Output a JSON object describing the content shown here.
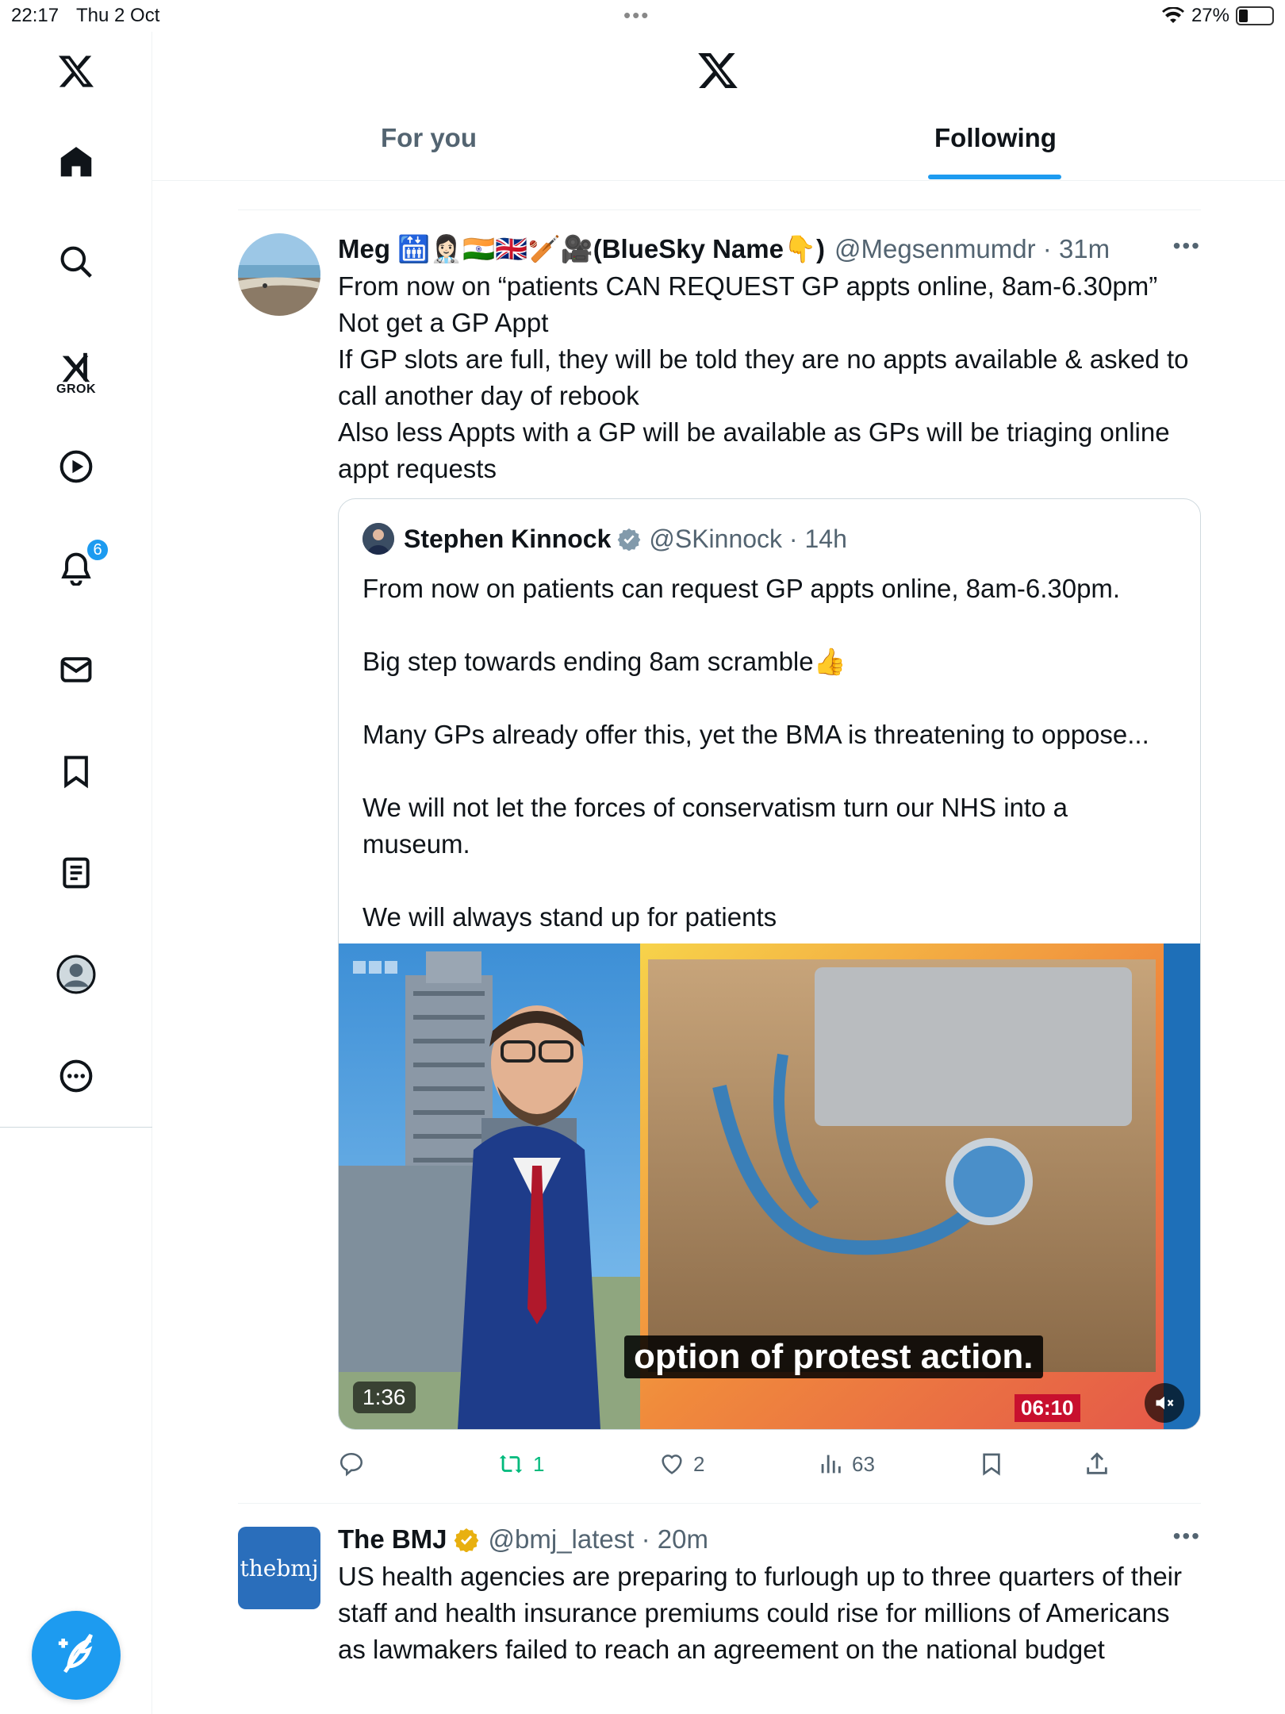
{
  "status_bar": {
    "time": "22:17",
    "date": "Thu 2 Oct",
    "battery_text": "27%",
    "battery_level": 0.27
  },
  "sidebar": {
    "items": [
      {
        "name": "x-logo",
        "icon": "x-logo-icon"
      },
      {
        "name": "home",
        "icon": "home-icon"
      },
      {
        "name": "search",
        "icon": "search-icon"
      },
      {
        "name": "grok",
        "icon": "grok-icon",
        "label": "GROK"
      },
      {
        "name": "video",
        "icon": "play-icon"
      },
      {
        "name": "notifications",
        "icon": "bell-icon",
        "badge": "6"
      },
      {
        "name": "messages",
        "icon": "mail-icon"
      },
      {
        "name": "bookmarks",
        "icon": "bookmark-icon"
      },
      {
        "name": "articles",
        "icon": "article-icon"
      },
      {
        "name": "profile",
        "icon": "profile-icon"
      },
      {
        "name": "more",
        "icon": "more-circle-icon"
      }
    ],
    "compose_icon": "compose-feather-icon"
  },
  "header": {
    "tabs": [
      {
        "label": "For you",
        "active": false
      },
      {
        "label": "Following",
        "active": true
      }
    ],
    "accent": "#1d9bf0"
  },
  "tweets": [
    {
      "name": "Meg 🛗👩🏻‍⚕️🇮🇳🇬🇧🏏🎥(BlueSky Name👇)",
      "handle": "@Megsenmumdr",
      "time": "31m",
      "meta": "@Megsenmumdr · 31m",
      "text": "From now on “patients CAN REQUEST GP appts online, 8am-6.30pm”\nNot get a GP Appt\nIf GP slots are full, they will be told they are no appts available & asked to call another day of rebook\nAlso less Appts with a GP will be available as GPs will be triaging online appt requests",
      "quote": {
        "name": "Stephen Kinnock",
        "meta": "@SKinnock · 14h",
        "text": "From now on patients can request GP appts online, 8am-6.30pm.\n\nBig step towards ending 8am scramble👍\n\nMany GPs already offer this, yet the BMA is threatening to oppose...\n\nWe will not let the forces of conservatism turn our NHS into a museum.\n\nWe will always stand up for patients",
        "video": {
          "caption": "option of protest action.",
          "duration": "1:36",
          "clock": "06:10",
          "channel": "BBC"
        }
      },
      "actions": {
        "replies": "",
        "reposts": "1",
        "likes": "2",
        "views": "63"
      }
    },
    {
      "name": "The BMJ",
      "meta": "@bmj_latest · 20m",
      "avatar_text": "thebmj",
      "text": "US health agencies are preparing to furlough up to three quarters of their staff and health insurance premiums could rise for millions of Americans as lawmakers failed to reach an agreement on the national budget"
    }
  ],
  "colors": {
    "repost_green": "#00ba7c",
    "verified_gold": "#e8b010",
    "text_secondary": "#536471"
  }
}
